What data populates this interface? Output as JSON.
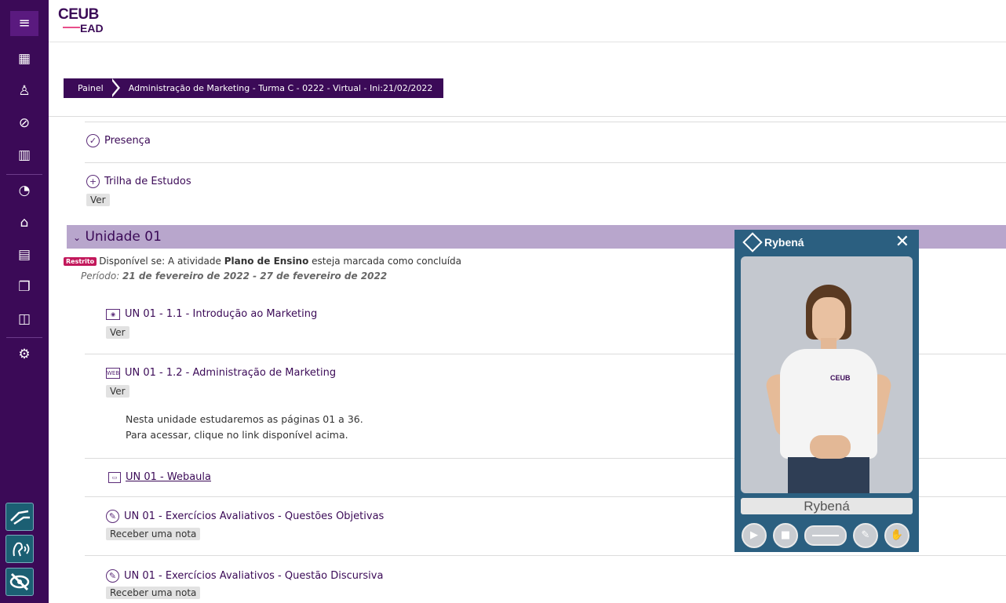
{
  "header": {
    "logo_top": "CEUB",
    "logo_bottom": "EAD"
  },
  "rail": {
    "menu_icon": "hamburger-icon",
    "items": [
      "dashboard-icon",
      "participants-icon",
      "check-icon",
      "book-icon",
      "speedometer-icon",
      "home-icon",
      "calendar-icon",
      "files-icon",
      "clipboard-icon",
      "settings-icon"
    ]
  },
  "breadcrumb": {
    "home": "Painel",
    "course": "Administração de Marketing - Turma C - 0222 - Virtual - Ini:21/02/2022"
  },
  "activities_top": [
    {
      "title": "Presença"
    },
    {
      "title": "Trilha de Estudos",
      "tag": "Ver"
    }
  ],
  "unit": {
    "title": "Unidade 01",
    "restrict_badge": "Restrito",
    "restrict_prefix": "Disponível se: A atividade ",
    "restrict_activity": "Plano de Ensino",
    "restrict_suffix": " esteja marcada como concluída",
    "period_label": "Período: ",
    "period_value": "21 de fevereiro de 2022 - 27 de fevereiro de 2022"
  },
  "activities": [
    {
      "title": "UN 01 - 1.1 - Introdução ao Marketing",
      "tag": "Ver"
    },
    {
      "title": "UN 01 - 1.2 - Administração de Marketing",
      "tag": "Ver",
      "desc1": "Nesta unidade estudaremos as páginas 01 a 36.",
      "desc2": "Para acessar, clique no link disponível acima."
    },
    {
      "title": "UN 01 - Webaula"
    },
    {
      "title": "UN 01 - Exercícios Avaliativos - Questões Objetivas",
      "tag": "Receber uma nota"
    },
    {
      "title": "UN 01 - Exercícios Avaliativos - Questão Discursiva",
      "tag": "Receber uma nota"
    }
  ],
  "rybena": {
    "title": "Rybená",
    "close": "✕",
    "name": "Rybená"
  }
}
